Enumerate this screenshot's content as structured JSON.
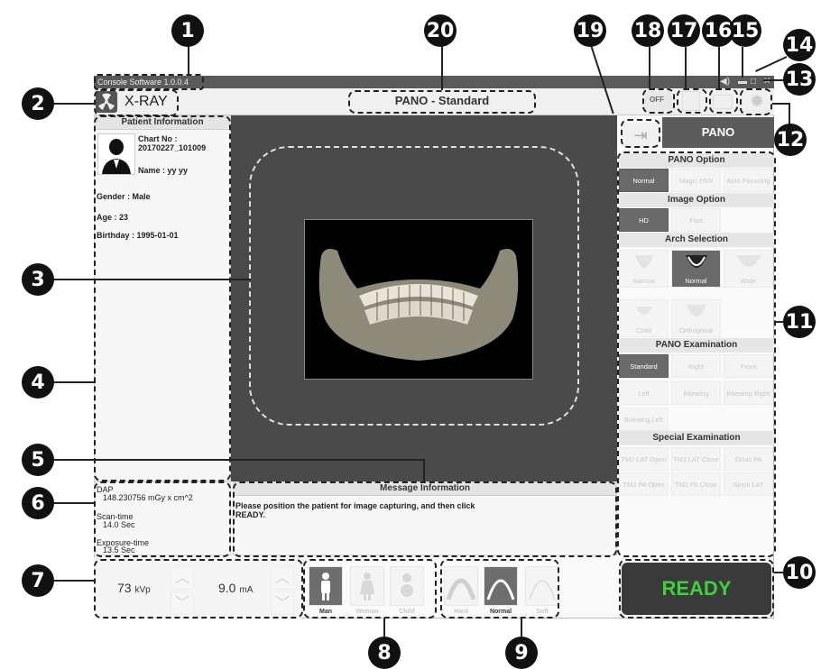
{
  "callouts": [
    "1",
    "2",
    "3",
    "4",
    "5",
    "6",
    "7",
    "8",
    "9",
    "10",
    "11",
    "12",
    "13",
    "14",
    "15",
    "16",
    "17",
    "18",
    "19",
    "20"
  ],
  "titlebar": {
    "title": "Console Software  1.0.0.4",
    "min": "▬",
    "max": "□",
    "close": "✕",
    "sound": "◀)"
  },
  "header": {
    "app_label": "X-RAY",
    "mode_title": "PANO - Standard",
    "off_label": "OFF"
  },
  "patient": {
    "section_title": "Patient Information",
    "chart_label": "Chart No :",
    "chart_no": "20170227_101009",
    "name": "Name : yy yy",
    "gender": "Gender : Male",
    "age": "Age : 23",
    "birthday": "Birthday : 1995-01-01"
  },
  "dose": {
    "dap_label": "DAP",
    "dap_value": "148.230756 mGy x cm^2",
    "scan_label": "Scan-time",
    "scan_value": "14.0 Sec",
    "exposure_label": "Exposure-time",
    "exposure_value": "13.5 Sec"
  },
  "message": {
    "title": "Message Information",
    "text_line1": "Please position the patient for image capturing, and then click",
    "text_line2": "READY."
  },
  "exposure": {
    "kvp_value": "73",
    "kvp_unit": "kVp",
    "ma_value": "9.0",
    "ma_unit": "mA"
  },
  "patient_type": {
    "man": "Man",
    "woman": "Woman",
    "child": "Child"
  },
  "density": {
    "hard": "Hard",
    "normal": "Normal",
    "soft": "Soft"
  },
  "right": {
    "mode_button": "PANO",
    "pano_option_title": "PANO Option",
    "pano_options": [
      "Normal",
      "Magic PAN",
      "Auto Focusing"
    ],
    "image_option_title": "Image Option",
    "image_options": [
      "HD",
      "Fast"
    ],
    "arch_title": "Arch Selection",
    "arch_options": [
      "Narrow",
      "Normal",
      "Wide",
      "Child",
      "Orthogonal"
    ],
    "exam_title": "PANO Examination",
    "exam_options": [
      "Standard",
      "Right",
      "Front",
      "Left",
      "Bitewing",
      "Bitewing Right",
      "Bitewing Left"
    ],
    "special_title": "Special Examination",
    "special_options": [
      "TMJ LAT Open",
      "TMJ LAT Close",
      "Sinus PA",
      "TMJ PA Open",
      "TMJ PA Close",
      "Sinus LAT"
    ]
  },
  "ready_button": "READY",
  "colors": {
    "ready_green": "#3cd23c",
    "ready_bg": "#3a3a3a",
    "viewer_bg": "#4a4a4a",
    "selected": "#6a6a6a"
  }
}
